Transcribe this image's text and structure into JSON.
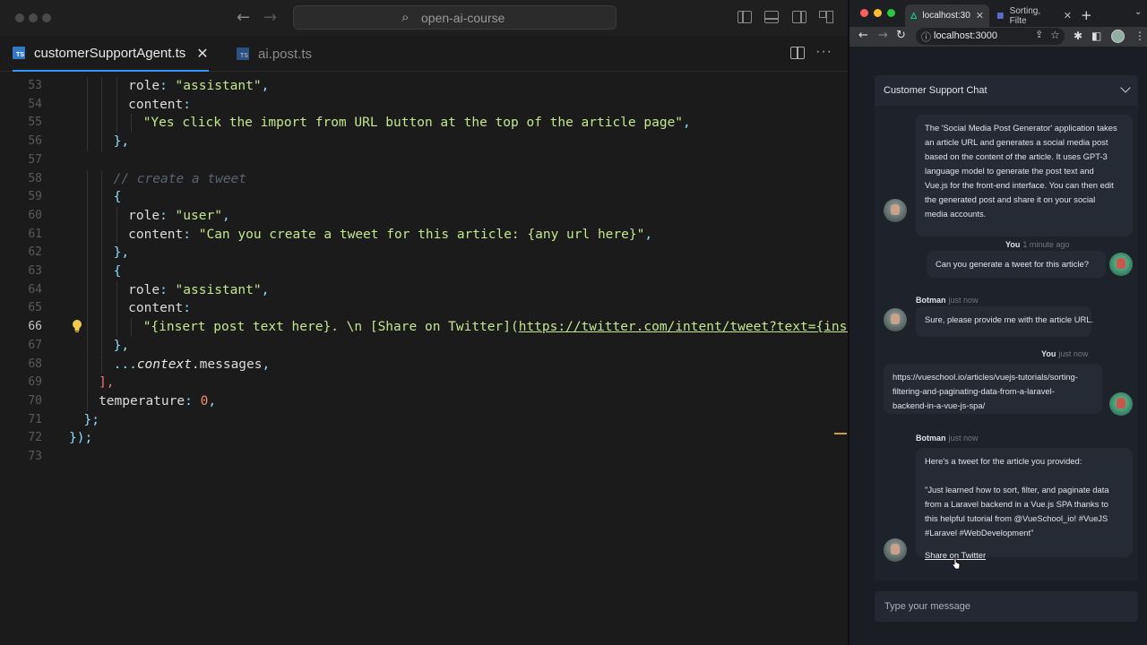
{
  "editor": {
    "search_text": "open-ai-course",
    "tabs": [
      {
        "label": "customerSupportAgent.ts",
        "icon": "typescript-file-icon",
        "active": true
      },
      {
        "label": "ai.post.ts",
        "icon": "typescript-file-icon",
        "active": false
      }
    ],
    "ts_badge": "TS",
    "close_glyph": "✕",
    "more_glyph": "···",
    "current_line": "66",
    "lines": [
      {
        "n": "53",
        "indent": 4,
        "tokens": [
          [
            "key",
            "role"
          ],
          [
            "pun",
            ": "
          ],
          [
            "str",
            "\"assistant\""
          ],
          [
            "pun",
            ","
          ]
        ]
      },
      {
        "n": "54",
        "indent": 4,
        "tokens": [
          [
            "key",
            "content"
          ],
          [
            "pun",
            ":"
          ]
        ]
      },
      {
        "n": "55",
        "indent": 5,
        "tokens": [
          [
            "str",
            "\"Yes click the import from URL button at the top of the article page\""
          ],
          [
            "pun",
            ","
          ]
        ]
      },
      {
        "n": "56",
        "indent": 3,
        "tokens": [
          [
            "pun",
            "},"
          ]
        ]
      },
      {
        "n": "57",
        "indent": 0,
        "tokens": []
      },
      {
        "n": "58",
        "indent": 3,
        "tokens": [
          [
            "cmt",
            "// create a tweet"
          ]
        ]
      },
      {
        "n": "59",
        "indent": 3,
        "tokens": [
          [
            "pun",
            "{"
          ]
        ]
      },
      {
        "n": "60",
        "indent": 4,
        "tokens": [
          [
            "key",
            "role"
          ],
          [
            "pun",
            ": "
          ],
          [
            "str",
            "\"user\""
          ],
          [
            "pun",
            ","
          ]
        ]
      },
      {
        "n": "61",
        "indent": 4,
        "tokens": [
          [
            "key",
            "content"
          ],
          [
            "pun",
            ": "
          ],
          [
            "str",
            "\"Can you create a tweet for this article: {any url here}\""
          ],
          [
            "pun",
            ","
          ]
        ]
      },
      {
        "n": "62",
        "indent": 3,
        "tokens": [
          [
            "pun",
            "},"
          ]
        ]
      },
      {
        "n": "63",
        "indent": 3,
        "tokens": [
          [
            "pun",
            "{"
          ]
        ]
      },
      {
        "n": "64",
        "indent": 4,
        "tokens": [
          [
            "key",
            "role"
          ],
          [
            "pun",
            ": "
          ],
          [
            "str",
            "\"assistant\""
          ],
          [
            "pun",
            ","
          ]
        ]
      },
      {
        "n": "65",
        "indent": 4,
        "tokens": [
          [
            "key",
            "content"
          ],
          [
            "pun",
            ":"
          ]
        ]
      },
      {
        "n": "66",
        "indent": 5,
        "tokens": [
          [
            "str",
            "\"{insert post text here}. \\n [Share on Twitter]("
          ],
          [
            "url",
            "https://twitter.com/intent/tweet?text={insert p"
          ]
        ]
      },
      {
        "n": "67",
        "indent": 3,
        "tokens": [
          [
            "pun",
            "},"
          ]
        ]
      },
      {
        "n": "68",
        "indent": 3,
        "tokens": [
          [
            "pun",
            "..."
          ],
          [
            "it",
            "context"
          ],
          [
            "key",
            ".messages"
          ],
          [
            "pun",
            ","
          ]
        ]
      },
      {
        "n": "69",
        "indent": 2,
        "tokens": [
          [
            "red",
            "],"
          ]
        ]
      },
      {
        "n": "70",
        "indent": 2,
        "tokens": [
          [
            "key",
            "temperature"
          ],
          [
            "pun",
            ": "
          ],
          [
            "num",
            "0"
          ],
          [
            "pun",
            ","
          ]
        ]
      },
      {
        "n": "71",
        "indent": 1,
        "tokens": [
          [
            "pun",
            "};"
          ]
        ]
      },
      {
        "n": "72",
        "indent": 0,
        "tokens": [
          [
            "pun",
            "});"
          ]
        ]
      },
      {
        "n": "73",
        "indent": 0,
        "tokens": []
      }
    ]
  },
  "browser": {
    "tabs": [
      {
        "label": "localhost:30",
        "active": true
      },
      {
        "label": "Sorting, Filte",
        "active": false
      }
    ],
    "new_tab_glyph": "+",
    "url": "localhost:3000",
    "chat": {
      "title": "Customer Support Chat",
      "messages": [
        {
          "role": "bot",
          "lines": [
            "The 'Social Media Post Generator' application takes",
            "an article URL and generates a social media post",
            "based on the content of the article. It uses GPT-3",
            "language model to generate the post text and",
            "Vue.js for the front-end interface. You can then edit",
            "the generated post and share it on your social",
            "media accounts."
          ]
        },
        {
          "role": "user",
          "sender": "You",
          "time": "1 minute ago",
          "lines": [
            "Can you generate a tweet for this article?"
          ]
        },
        {
          "role": "bot",
          "sender": "Botman",
          "time": "just now",
          "lines": [
            "Sure, please provide me with the article URL."
          ]
        },
        {
          "role": "user",
          "sender": "You",
          "time": "just now",
          "lines": [
            "https://vueschool.io/articles/vuejs-tutorials/sorting-",
            "filtering-and-paginating-data-from-a-laravel-",
            "backend-in-a-vue-js-spa/"
          ]
        },
        {
          "role": "bot",
          "sender": "Botman",
          "time": "just now",
          "lines": [
            "Here's a tweet for the article you provided:",
            "",
            "\"Just learned how to sort, filter, and paginate data",
            "from a Laravel backend in a Vue.js SPA thanks to",
            "this helpful tutorial from @VueSchool_io! #VueJS",
            "#Laravel #WebDevelopment\""
          ],
          "link": "Share on Twitter"
        }
      ],
      "input_placeholder": "Type your message"
    }
  },
  "colors": {
    "accent": "#3794ff",
    "ts_blue": "#3178c6",
    "string": "#c3e88d",
    "bubble_bg": "#252b35"
  }
}
